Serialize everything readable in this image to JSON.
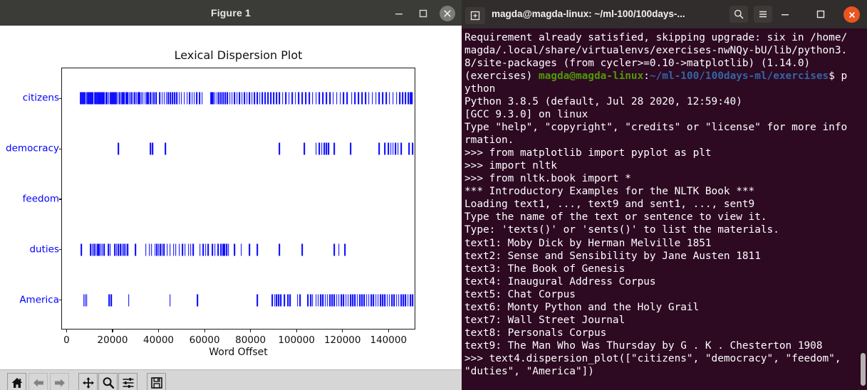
{
  "figure_window": {
    "title": "Figure 1",
    "controls": {
      "minimize": "minimize-icon",
      "maximize": "maximize-icon",
      "close": "close-icon"
    },
    "toolbar": {
      "buttons": [
        {
          "name": "home",
          "icon": "home-icon",
          "enabled": true
        },
        {
          "name": "back",
          "icon": "left-arrow-icon",
          "enabled": false
        },
        {
          "name": "forward",
          "icon": "right-arrow-icon",
          "enabled": false
        },
        {
          "name": "pan",
          "icon": "move-cross-icon",
          "enabled": true
        },
        {
          "name": "zoom",
          "icon": "magnifier-icon",
          "enabled": true
        },
        {
          "name": "configure-subplots",
          "icon": "sliders-icon",
          "enabled": true
        },
        {
          "name": "save",
          "icon": "floppy-disk-icon",
          "enabled": true
        }
      ]
    }
  },
  "chart_data": {
    "type": "scatter",
    "title": "Lexical Dispersion Plot",
    "xlabel": "Word Offset",
    "ylabel": "",
    "xlim": [
      -2000,
      152000
    ],
    "ylim": [
      -0.6,
      4.6
    ],
    "grid": false,
    "legend": null,
    "mark_color": "#0000ff",
    "tick_label_color": "#0000ff",
    "xticks": [
      0,
      20000,
      40000,
      60000,
      80000,
      100000,
      120000,
      140000
    ],
    "xtick_labels": [
      "0",
      "20000",
      "40000",
      "60000",
      "80000",
      "100000",
      "120000",
      "140000"
    ],
    "categories": [
      "citizens",
      "democracy",
      "feedom",
      "duties",
      "America"
    ],
    "ytick_labels": [
      "citizens",
      "democracy",
      "feedom",
      "duties",
      "America"
    ],
    "series": [
      {
        "name": "citizens",
        "row": 4,
        "values": [
          6200,
          6600,
          7000,
          7500,
          7900,
          8700,
          9100,
          9600,
          10200,
          10700,
          11400,
          12100,
          12700,
          13100,
          13600,
          14200,
          14800,
          15400,
          16000,
          16500,
          17200,
          17800,
          18400,
          19100,
          19700,
          20400,
          21000,
          21700,
          22400,
          23100,
          23900,
          24400,
          25100,
          25900,
          26600,
          27300,
          28100,
          28900,
          29600,
          30400,
          31200,
          31900,
          32600,
          33200,
          34100,
          34900,
          35600,
          36500,
          37300,
          38000,
          39000,
          40500,
          41600,
          42500,
          43400,
          44300,
          45200,
          46100,
          47000,
          48000,
          49000,
          50000,
          51200,
          52400,
          53500,
          54600,
          55600,
          56700,
          57800,
          59000,
          62800,
          63200,
          63700,
          64500,
          65400,
          66300,
          67200,
          68100,
          69000,
          70000,
          71000,
          72000,
          73000,
          74100,
          75200,
          76300,
          77400,
          78500,
          79600,
          80700,
          81800,
          82900,
          84000,
          85200,
          86400,
          87600,
          88800,
          90000,
          91300,
          92600,
          94000,
          95400,
          96800,
          98200,
          99600,
          101000,
          102500,
          104000,
          105500,
          107000,
          108500,
          110000,
          111500,
          113000,
          114500,
          116000,
          117500,
          119000,
          120500,
          122000,
          124000,
          125500,
          127000,
          128500,
          130000,
          131500,
          133000,
          134500,
          136000,
          137500,
          139000,
          140500,
          142000,
          143500,
          145000,
          146200,
          147400,
          148600,
          149500,
          150200
        ]
      },
      {
        "name": "democracy",
        "row": 3,
        "values": [
          22500,
          36500,
          37500,
          43000,
          92500,
          103500,
          108500,
          110000,
          111000,
          112000,
          113000,
          114000,
          116500,
          123500,
          136000,
          138500,
          140000,
          141000,
          142000,
          143000,
          144200,
          145500,
          149000,
          150500
        ]
      },
      {
        "name": "feedom",
        "row": 2,
        "values": []
      },
      {
        "name": "duties",
        "row": 1,
        "values": [
          6500,
          10500,
          11200,
          12000,
          12800,
          13500,
          14200,
          14900,
          15600,
          16400,
          18200,
          19000,
          21000,
          21800,
          22600,
          23400,
          24200,
          25000,
          25800,
          26600,
          30000,
          34500,
          36000,
          37000,
          38500,
          39200,
          40000,
          40800,
          41600,
          42400,
          43800,
          45000,
          46500,
          47500,
          49000,
          50500,
          51500,
          53000,
          54000,
          55000,
          58000,
          59500,
          60500,
          61500,
          63500,
          64500,
          66000,
          67200,
          68000,
          68800,
          69600,
          70400,
          73000,
          76000,
          79500,
          83000,
          92500,
          102500,
          116500,
          118500,
          121000
        ]
      },
      {
        "name": "America",
        "row": 0,
        "values": [
          7500,
          8100,
          8700,
          18500,
          19400,
          27000,
          45000,
          57000,
          83000,
          89500,
          90500,
          91400,
          92300,
          93200,
          94800,
          96200,
          97200,
          100500,
          101500,
          105000,
          106200,
          107000,
          108500,
          109500,
          110500,
          111500,
          112500,
          113500,
          114500,
          115500,
          116500,
          117500,
          118500,
          119500,
          120500,
          121500,
          122500,
          123500,
          124500,
          125500,
          126500,
          127500,
          128500,
          129500,
          130500,
          131500,
          132500,
          133500,
          134500,
          135500,
          136500,
          137500,
          138500,
          139500,
          140500,
          141500,
          142500,
          143500,
          144500,
          145500,
          146500,
          147500,
          148500,
          149500,
          150500
        ]
      }
    ]
  },
  "terminal": {
    "title": "magda@magda-linux: ~/ml-100/100days-...",
    "controls": {
      "new_tab": "new-tab-icon",
      "search": "search-icon",
      "menu": "hamburger-menu-icon",
      "minimize": "minimize-icon",
      "maximize": "maximize-icon",
      "close": "close-icon"
    },
    "colors": {
      "background": "#2d0922",
      "foreground": "#ffffff",
      "prompt_user": "#4e9a06",
      "prompt_path": "#3465a4",
      "close_button": "#e95420"
    },
    "lines": [
      {
        "segments": [
          {
            "text": "Requirement already satisfied, skipping upgrade: six in /home/",
            "color": "white"
          }
        ]
      },
      {
        "segments": [
          {
            "text": "magda/.local/share/virtualenvs/exercises-nwNQy-bU/lib/python3.",
            "color": "white"
          }
        ]
      },
      {
        "segments": [
          {
            "text": "8/site-packages (from cycler>=0.10->matplotlib) (1.14.0)",
            "color": "white"
          }
        ]
      },
      {
        "segments": [
          {
            "text": "(exercises) ",
            "color": "white"
          },
          {
            "text": "magda@magda-linux",
            "color": "green"
          },
          {
            "text": ":",
            "color": "white"
          },
          {
            "text": "~/ml-100/100days-ml/exercises",
            "color": "blue"
          },
          {
            "text": "$ p",
            "color": "white"
          }
        ]
      },
      {
        "segments": [
          {
            "text": "ython",
            "color": "white"
          }
        ]
      },
      {
        "segments": [
          {
            "text": "Python 3.8.5 (default, Jul 28 2020, 12:59:40)",
            "color": "white"
          }
        ]
      },
      {
        "segments": [
          {
            "text": "[GCC 9.3.0] on linux",
            "color": "white"
          }
        ]
      },
      {
        "segments": [
          {
            "text": "Type \"help\", \"copyright\", \"credits\" or \"license\" for more info",
            "color": "white"
          }
        ]
      },
      {
        "segments": [
          {
            "text": "rmation.",
            "color": "white"
          }
        ]
      },
      {
        "segments": [
          {
            "text": ">>> from matplotlib import pyplot as plt",
            "color": "white"
          }
        ]
      },
      {
        "segments": [
          {
            "text": ">>> import nltk",
            "color": "white"
          }
        ]
      },
      {
        "segments": [
          {
            "text": ">>> from nltk.book import *",
            "color": "white"
          }
        ]
      },
      {
        "segments": [
          {
            "text": "*** Introductory Examples for the NLTK Book ***",
            "color": "white"
          }
        ]
      },
      {
        "segments": [
          {
            "text": "Loading text1, ..., text9 and sent1, ..., sent9",
            "color": "white"
          }
        ]
      },
      {
        "segments": [
          {
            "text": "Type the name of the text or sentence to view it.",
            "color": "white"
          }
        ]
      },
      {
        "segments": [
          {
            "text": "Type: 'texts()' or 'sents()' to list the materials.",
            "color": "white"
          }
        ]
      },
      {
        "segments": [
          {
            "text": "text1: Moby Dick by Herman Melville 1851",
            "color": "white"
          }
        ]
      },
      {
        "segments": [
          {
            "text": "text2: Sense and Sensibility by Jane Austen 1811",
            "color": "white"
          }
        ]
      },
      {
        "segments": [
          {
            "text": "text3: The Book of Genesis",
            "color": "white"
          }
        ]
      },
      {
        "segments": [
          {
            "text": "text4: Inaugural Address Corpus",
            "color": "white"
          }
        ]
      },
      {
        "segments": [
          {
            "text": "text5: Chat Corpus",
            "color": "white"
          }
        ]
      },
      {
        "segments": [
          {
            "text": "text6: Monty Python and the Holy Grail",
            "color": "white"
          }
        ]
      },
      {
        "segments": [
          {
            "text": "text7: Wall Street Journal",
            "color": "white"
          }
        ]
      },
      {
        "segments": [
          {
            "text": "text8: Personals Corpus",
            "color": "white"
          }
        ]
      },
      {
        "segments": [
          {
            "text": "text9: The Man Who Was Thursday by G . K . Chesterton 1908",
            "color": "white"
          }
        ]
      },
      {
        "segments": [
          {
            "text": ">>> text4.dispersion_plot([\"citizens\", \"democracy\", \"feedom\", ",
            "color": "white"
          }
        ]
      },
      {
        "segments": [
          {
            "text": "\"duties\", \"America\"])",
            "color": "white"
          }
        ]
      }
    ]
  }
}
